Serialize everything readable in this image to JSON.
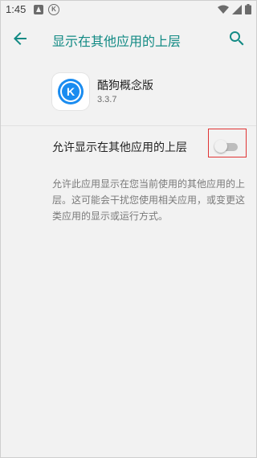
{
  "status_bar": {
    "time": "1:45",
    "icons": [
      "notification-a-icon",
      "kugou-k-icon",
      "wifi-icon",
      "signal-icon",
      "battery-icon"
    ]
  },
  "app_bar": {
    "title": "显示在其他应用的上层",
    "back_icon": "arrow-back-icon",
    "search_icon": "search-icon",
    "accent_color": "#128a84"
  },
  "app": {
    "name": "酷狗概念版",
    "version": "3.3.7",
    "icon": "kugou-app-icon",
    "icon_letter": "K"
  },
  "setting": {
    "label": "允许显示在其他应用的上层",
    "enabled": false
  },
  "description": "允许此应用显示在您当前使用的其他应用的上层。这可能会干扰您使用相关应用，或变更这类应用的显示或运行方式。",
  "highlight_color": "#e03434"
}
